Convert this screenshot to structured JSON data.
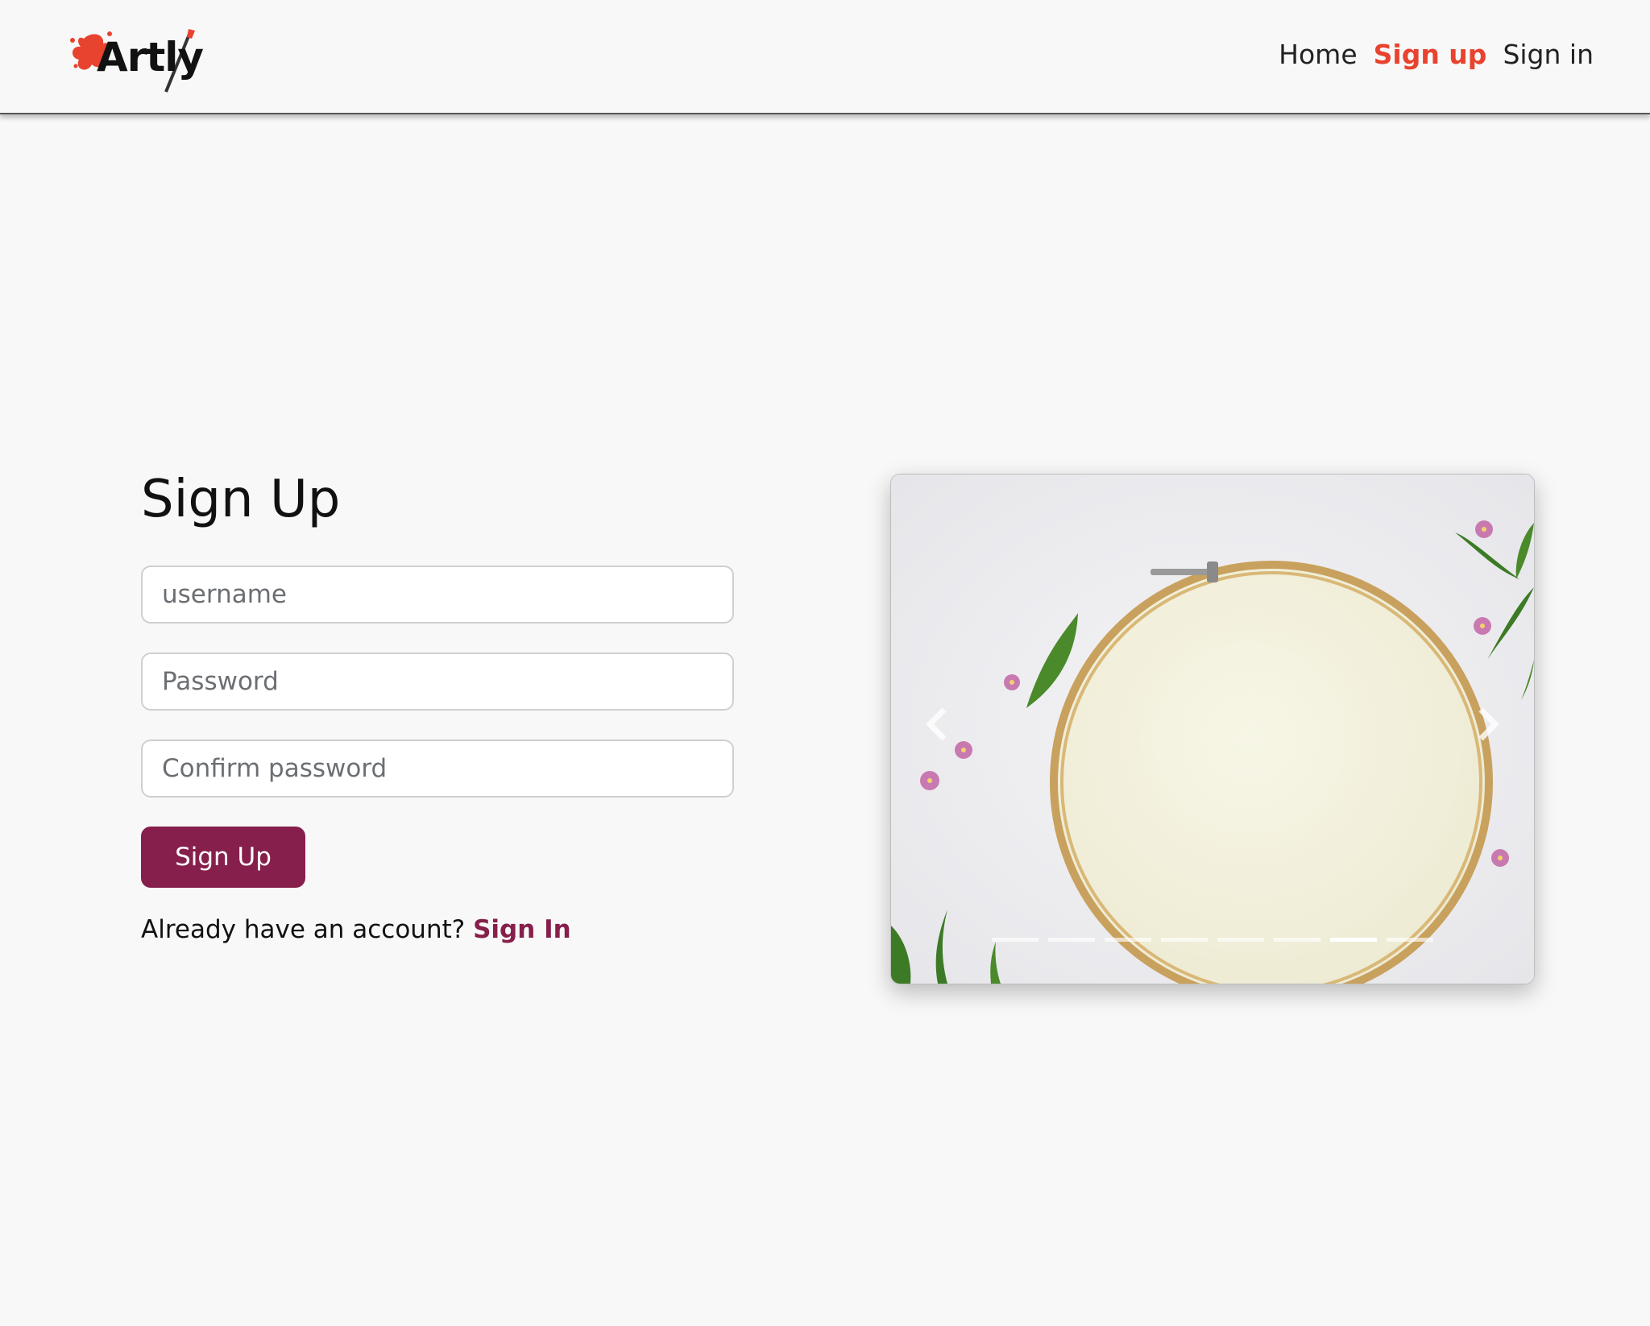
{
  "brand": {
    "name": "Artly"
  },
  "nav": {
    "home": "Home",
    "signup": "Sign up",
    "signin": "Sign in"
  },
  "form": {
    "title": "Sign Up",
    "username_placeholder": "username",
    "password_placeholder": "Password",
    "confirm_placeholder": "Confirm password",
    "submit_label": "Sign Up",
    "already_text": "Already have an account?",
    "signin_link": "Sign In"
  },
  "carousel": {
    "slide_count": 8,
    "active_index": 6
  },
  "colors": {
    "accent": "#861f4b",
    "nav_active": "#e8432f",
    "background": "#f8f8f8"
  }
}
